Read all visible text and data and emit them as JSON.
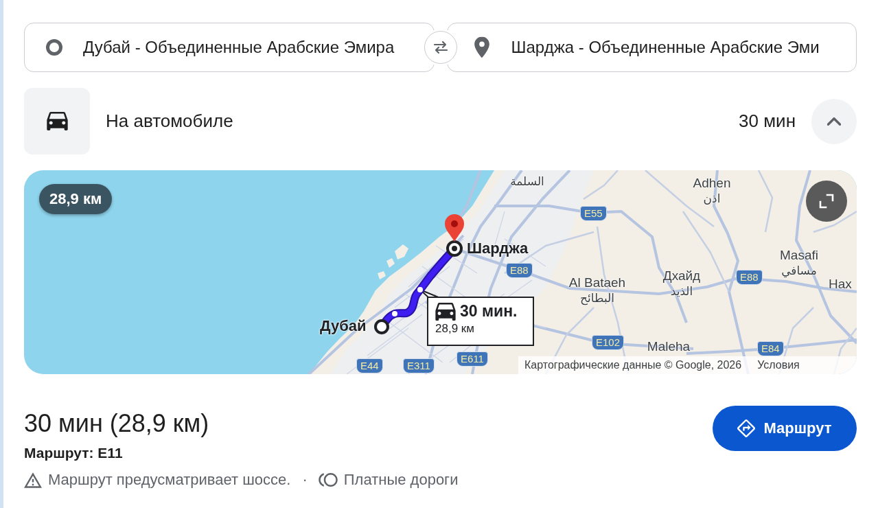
{
  "route_inputs": {
    "origin": {
      "value": "Дубай - Объединенные Арабские Эмира"
    },
    "destination": {
      "value": "Шарджа - Объединенные Арабские Эми"
    }
  },
  "travel_mode": {
    "label": "На автомобиле",
    "duration": "30 мин",
    "expanded": true
  },
  "map": {
    "distance_badge": "28,9 км",
    "places": [
      {
        "kind": "endpoint",
        "name": "Шарджа"
      },
      {
        "kind": "endpoint",
        "name": "Дубай"
      },
      {
        "kind": "town",
        "name": "Adhen",
        "local_name": "اذن"
      },
      {
        "kind": "town",
        "name": "Al Bataeh",
        "local_name": "البطائح"
      },
      {
        "kind": "town",
        "name": "Дхайд",
        "local_name": "الذيد"
      },
      {
        "kind": "town",
        "name": "Masafi",
        "local_name": "مسافي"
      },
      {
        "kind": "town",
        "name": "Maleha"
      },
      {
        "kind": "town",
        "local_name": "السلمة"
      },
      {
        "kind": "town",
        "name": "Нах"
      }
    ],
    "road_shields": [
      "E55",
      "E88",
      "E88",
      "E102",
      "E84",
      "E611",
      "E44",
      "E311"
    ],
    "route_callout": {
      "duration": "30 мин.",
      "distance": "28,9 км"
    },
    "attribution": "Картографические данные © Google, 2026",
    "terms_link": "Условия"
  },
  "summary": {
    "title": "30 мин (28,9 км)",
    "via": "Маршрут: E11",
    "notes": [
      {
        "kind": "warning",
        "text": "Маршрут предусматривает шоссе."
      },
      {
        "kind": "toll",
        "text": "Платные дороги"
      }
    ],
    "note_separator": "·"
  },
  "directions_button": {
    "label": "Маршрут"
  }
}
